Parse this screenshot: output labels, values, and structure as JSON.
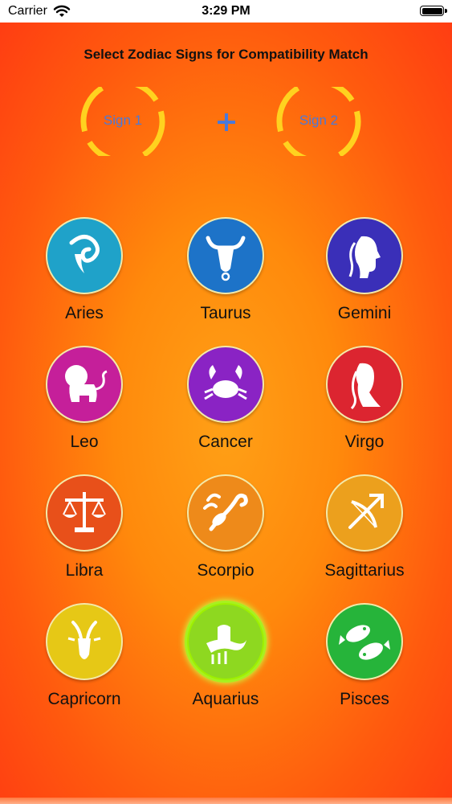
{
  "status_bar": {
    "carrier": "Carrier",
    "time": "3:29 PM",
    "wifi_icon": "wifi-icon",
    "battery_icon": "battery-icon"
  },
  "header": {
    "title": "Select Zodiac Signs for Compatibility Match"
  },
  "selection": {
    "sign1_label": "Sign 1",
    "sign2_label": "Sign 2",
    "plus_icon": "plus-icon",
    "ring_color": "#ffd21f",
    "label_color": "#4b79d9"
  },
  "signs": [
    {
      "name": "Aries",
      "color": "#1fa2c9",
      "icon": "ram-icon"
    },
    {
      "name": "Taurus",
      "color": "#1d73c8",
      "icon": "bull-icon"
    },
    {
      "name": "Gemini",
      "color": "#3a2fb8",
      "icon": "twins-icon"
    },
    {
      "name": "Leo",
      "color": "#c51f9a",
      "icon": "lion-icon"
    },
    {
      "name": "Cancer",
      "color": "#8a23c4",
      "icon": "crab-icon"
    },
    {
      "name": "Virgo",
      "color": "#dc2530",
      "icon": "maiden-icon"
    },
    {
      "name": "Libra",
      "color": "#e8501a",
      "icon": "scales-icon"
    },
    {
      "name": "Scorpio",
      "color": "#ee8a1a",
      "icon": "scorpion-icon"
    },
    {
      "name": "Sagittarius",
      "color": "#eca01d",
      "icon": "archer-icon"
    },
    {
      "name": "Capricorn",
      "color": "#e6c816",
      "icon": "goat-icon"
    },
    {
      "name": "Aquarius",
      "color": "#8ed820",
      "icon": "water-bearer-icon"
    },
    {
      "name": "Pisces",
      "color": "#26b43a",
      "icon": "fish-icon"
    }
  ]
}
